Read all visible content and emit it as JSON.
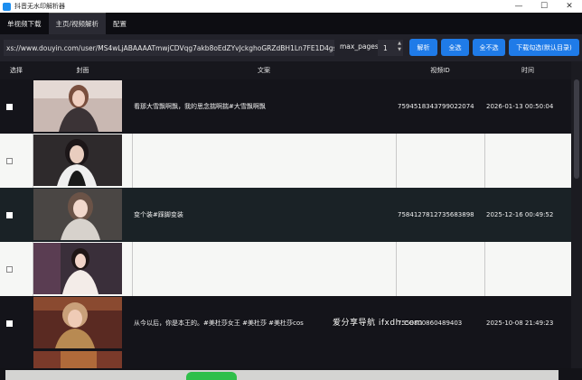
{
  "window": {
    "title": "抖音无水印解析器",
    "controls": {
      "minimize": "—",
      "maximize": "☐",
      "close": "✕"
    }
  },
  "tabs": [
    {
      "label": "单视频下载",
      "active": false
    },
    {
      "label": "主页/视频解析",
      "active": true
    },
    {
      "label": "配置",
      "active": false
    }
  ],
  "toolbar": {
    "url_value": "xs://www.douyin.com/user/MS4wLjABAAAATmwjCDVqg7akb8oEdZYvJckghoGRZdBH1Ln7FE1D4gs",
    "max_pages_label": "max_pages",
    "max_pages_value": "1",
    "parse_btn": "解析",
    "select_all_btn": "全选",
    "select_none_btn": "全不选",
    "download_btn": "下载勾选(默认目录)",
    "accent_color": "#1f7be8"
  },
  "table": {
    "headers": {
      "select": "选择",
      "cover": "封面",
      "text": "文案",
      "video_id": "视频ID",
      "time": "时间"
    },
    "rows": [
      {
        "text": "看那大雪飘啊飘，我的思念揣啊揣#大雪飘啊飘",
        "video_id": "7594518343799022074",
        "time": "2026-01-13 00:50:04",
        "style": "dark"
      },
      {
        "text": "",
        "video_id": "",
        "time": "",
        "style": "light"
      },
      {
        "text": "变个装#踩脚变装",
        "video_id": "7584127812735683898",
        "time": "2025-12-16 00:49:52",
        "style": "teal"
      },
      {
        "text": "",
        "video_id": "",
        "time": "",
        "style": "light"
      },
      {
        "text": "从今以后，你是本王的。#美杜莎女王 #美杜莎 #美杜莎cos",
        "video_id": "7558800860489403",
        "time": "2025-10-08 21:49:23",
        "style": "dark"
      }
    ]
  },
  "watermark": "爱分享导航 ifxdh.com"
}
